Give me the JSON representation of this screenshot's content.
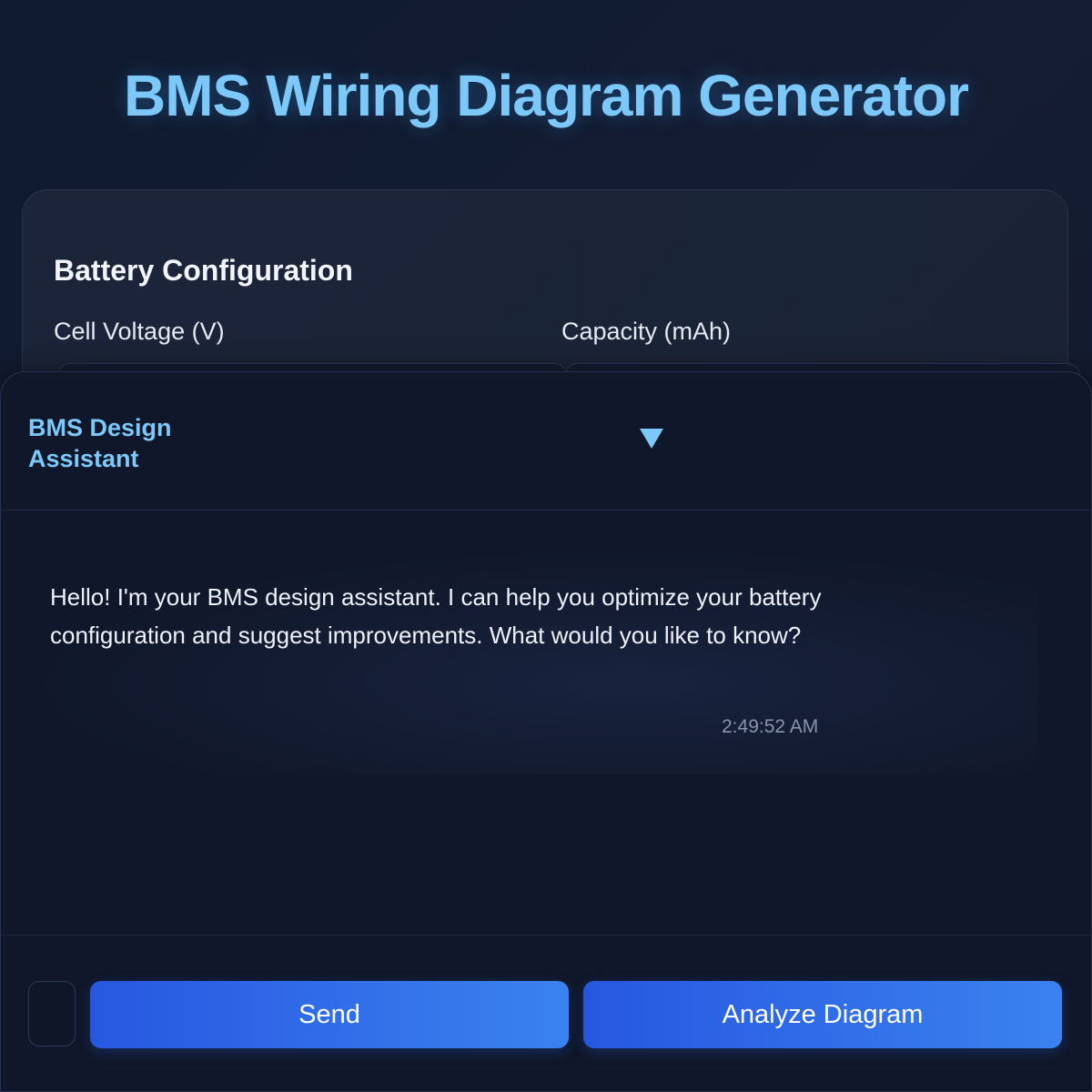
{
  "app": {
    "title": "BMS Wiring Diagram Generator"
  },
  "config": {
    "title": "Battery Configuration",
    "cell_voltage_label": "Cell Voltage (V)",
    "capacity_label": "Capacity (mAh)"
  },
  "chat": {
    "title": "BMS Design Assistant",
    "toggle_icon": "chevron-down-icon",
    "messages": [
      {
        "text": "Hello! I'm your BMS design assistant. I can help you optimize your battery configuration and suggest improvements. What would you like to know?",
        "time": "2:49:52 AM"
      }
    ],
    "send_label": "Send",
    "analyze_label": "Analyze Diagram"
  },
  "colors": {
    "accent": "#7cc8f8",
    "button_start": "#2657e0",
    "button_end": "#3b82f0",
    "panel_bg": "#10172a"
  }
}
